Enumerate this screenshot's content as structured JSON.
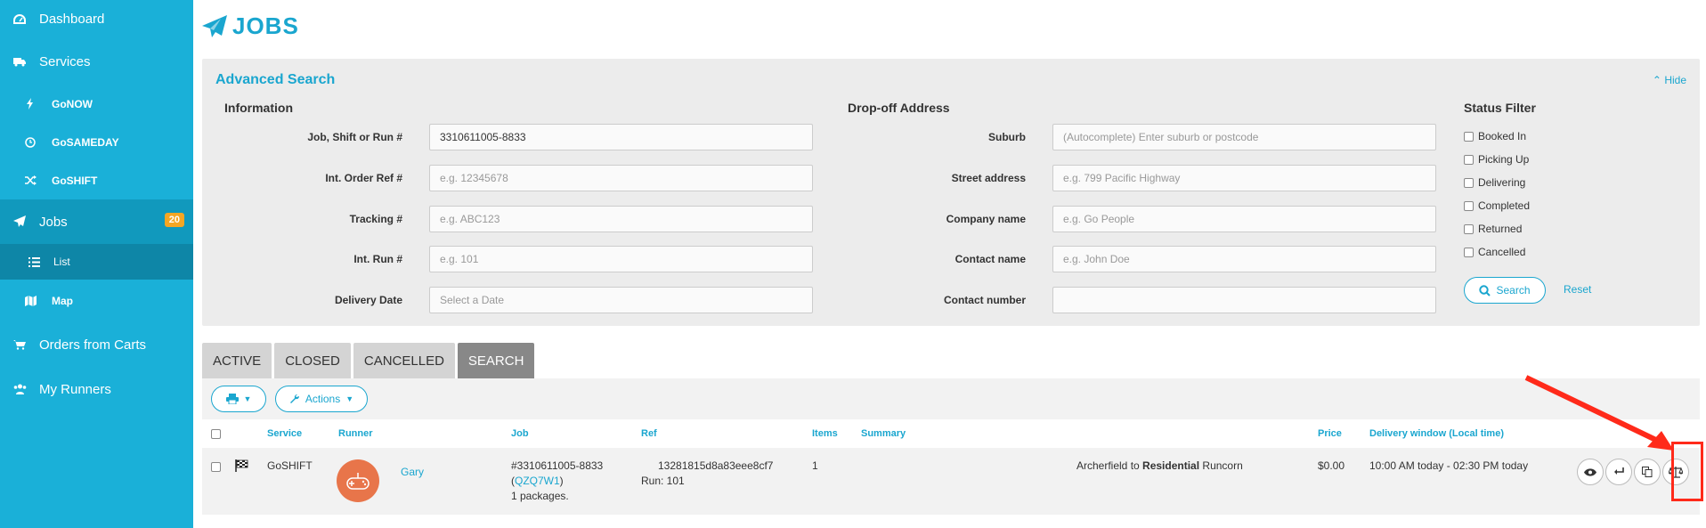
{
  "sidebar": {
    "items": [
      {
        "label": "Dashboard",
        "icon": "dashboard-icon"
      },
      {
        "label": "Services",
        "icon": "truck-icon"
      },
      {
        "label": "GoNOW",
        "icon": "bolt-icon"
      },
      {
        "label": "GoSAMEDAY",
        "icon": "clock-icon"
      },
      {
        "label": "GoSHIFT",
        "icon": "shuffle-icon"
      },
      {
        "label": "Jobs",
        "icon": "paper-plane-icon",
        "badge": "20"
      },
      {
        "label": "List",
        "icon": "list-icon"
      },
      {
        "label": "Map",
        "icon": "map-icon"
      },
      {
        "label": "Orders from Carts",
        "icon": "cart-icon"
      },
      {
        "label": "My Runners",
        "icon": "users-icon"
      }
    ]
  },
  "page": {
    "title": "JOBS"
  },
  "search": {
    "title": "Advanced Search",
    "hide": "Hide",
    "info_heading": "Information",
    "dropoff_heading": "Drop-off Address",
    "status_heading": "Status Filter",
    "fields_left": [
      {
        "label": "Job, Shift or Run #",
        "value": "3310611005-8833",
        "placeholder": ""
      },
      {
        "label": "Int. Order Ref #",
        "value": "",
        "placeholder": "e.g. 12345678"
      },
      {
        "label": "Tracking #",
        "value": "",
        "placeholder": "e.g. ABC123"
      },
      {
        "label": "Int. Run #",
        "value": "",
        "placeholder": "e.g. 101"
      },
      {
        "label": "Delivery Date",
        "value": "",
        "placeholder": "Select a Date"
      }
    ],
    "fields_right": [
      {
        "label": "Suburb",
        "value": "",
        "placeholder": "(Autocomplete) Enter suburb or postcode"
      },
      {
        "label": "Street address",
        "value": "",
        "placeholder": "e.g. 799 Pacific Highway"
      },
      {
        "label": "Company name",
        "value": "",
        "placeholder": "e.g. Go People"
      },
      {
        "label": "Contact name",
        "value": "",
        "placeholder": "e.g. John Doe"
      },
      {
        "label": "Contact number",
        "value": "",
        "placeholder": ""
      }
    ],
    "statuses": [
      "Booked In",
      "Picking Up",
      "Delivering",
      "Completed",
      "Returned",
      "Cancelled"
    ],
    "search_button": "Search",
    "reset": "Reset"
  },
  "tabs": [
    "ACTIVE",
    "CLOSED",
    "CANCELLED",
    "SEARCH"
  ],
  "toolbar": {
    "actions": "Actions"
  },
  "table": {
    "headers": [
      "Service",
      "Runner",
      "Job",
      "Ref",
      "Items",
      "Summary",
      "Price",
      "Delivery window (Local time)"
    ],
    "row": {
      "service": "GoSHIFT",
      "runner": "Gary",
      "job_number": "#3310611005-8833",
      "job_code": "QZQ7W1",
      "packages": "1 packages.",
      "ref": "13281815d8a83eee8cf7",
      "run": "Run: 101",
      "items": "1",
      "route_from": "Archerfield to",
      "route_type": "Residential",
      "route_to": "Runcorn",
      "price": "$0.00",
      "window": "10:00 AM today - 02:30 PM today"
    }
  },
  "colors": {
    "accent": "#1ab0d8",
    "badge": "#f5a623",
    "highlight": "#ff2a1a"
  }
}
